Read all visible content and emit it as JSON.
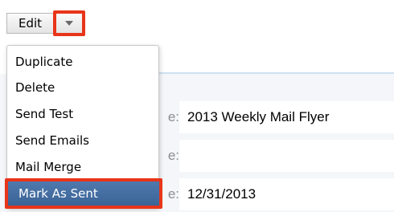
{
  "toolbar": {
    "edit_label": "Edit",
    "menu_toggle_icon": "chevron-down-icon",
    "highlight_color": "#e8351a"
  },
  "menu": {
    "items": [
      {
        "label": "Duplicate"
      },
      {
        "label": "Delete"
      },
      {
        "label": "Send Test"
      },
      {
        "label": "Send Emails"
      },
      {
        "label": "Mail Merge"
      },
      {
        "label": "Mark As Sent",
        "highlighted": true
      }
    ],
    "active_bg": "#3f6a9e"
  },
  "details": {
    "rows": [
      {
        "label_fragment": "e:",
        "value": "2013 Weekly Mail Flyer"
      },
      {
        "label_fragment": "e:",
        "value": ""
      },
      {
        "label_fragment": "e:",
        "value": "12/31/2013"
      }
    ]
  }
}
